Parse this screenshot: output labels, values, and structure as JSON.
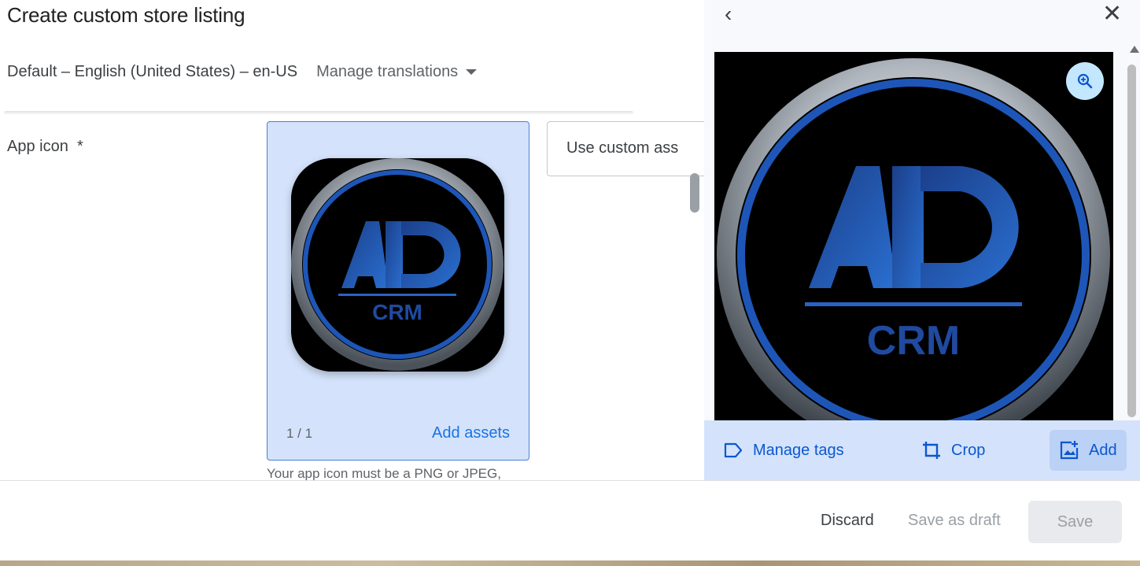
{
  "page": {
    "title": "Create custom store listing",
    "language_label": "Default – English (United States) – en-US",
    "manage_translations": "Manage translations"
  },
  "app_icon": {
    "label": "App icon",
    "required_mark": "*",
    "count": "1 / 1",
    "add_assets": "Add assets",
    "custom_button": "Use custom ass",
    "help_text": "Your app icon must be a PNG or JPEG,",
    "logo_text": "CRM",
    "logo_letters": "AD"
  },
  "preview_panel": {
    "back": "‹",
    "close": "✕",
    "manage_tags": "Manage tags",
    "crop": "Crop",
    "add": "Add"
  },
  "footer": {
    "discard": "Discard",
    "save_draft": "Save as draft",
    "save": "Save"
  },
  "colors": {
    "accent": "#1a73e8",
    "selected_card": "#d4e3fb",
    "zoom_button": "#c2e7ff"
  }
}
